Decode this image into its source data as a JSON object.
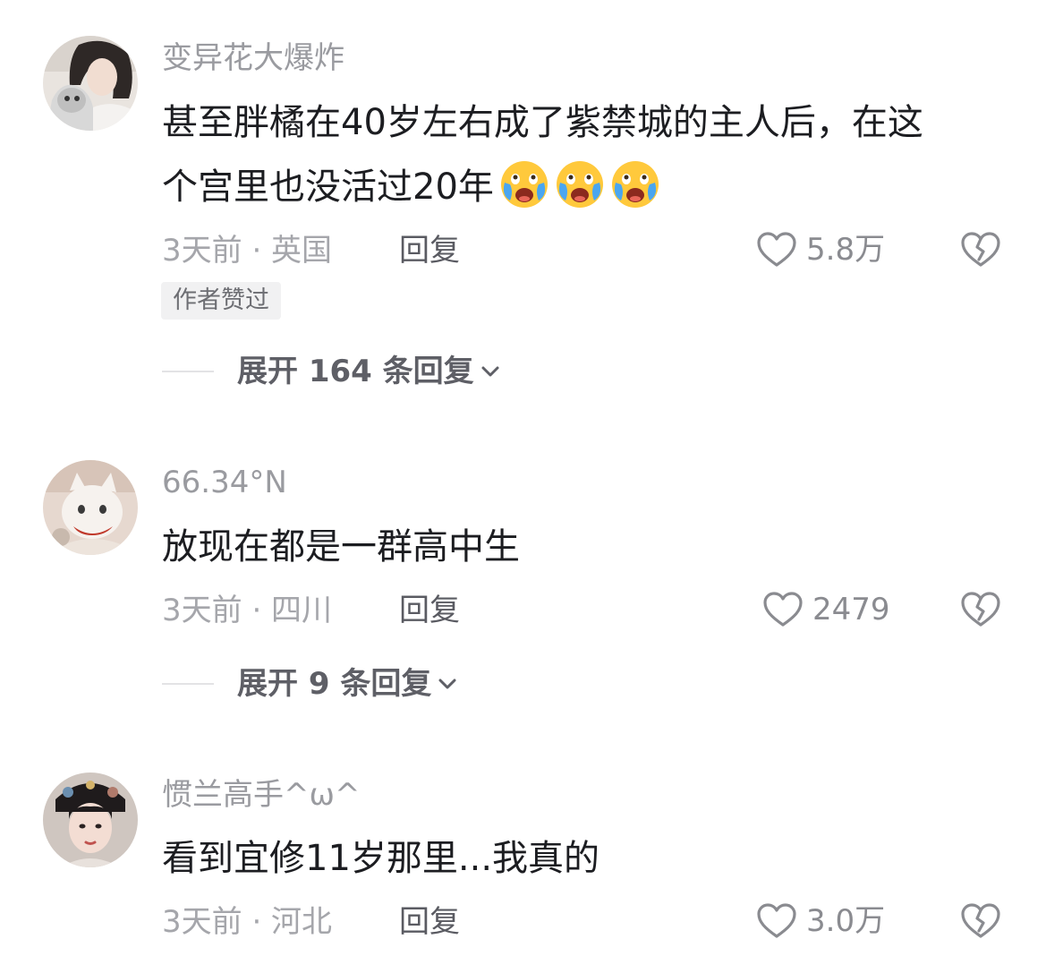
{
  "comments": [
    {
      "username": "变异花大爆炸",
      "content_line1": "甚至胖橘在40岁左右成了紫禁城的主人后，在这",
      "content_line2": "个宫里也没活过20年",
      "emoji": "crying-face-emoji",
      "emoji_count": 3,
      "meta": "3天前 · 英国",
      "reply_label": "回复",
      "likes": "5.8万",
      "badge": "作者赞过",
      "expand_label": "展开 164 条回复"
    },
    {
      "username": "66.34°N",
      "content_line1": "放现在都是一群高中生",
      "meta": "3天前 · 四川",
      "reply_label": "回复",
      "likes": "2479",
      "expand_label": "展开 9 条回复"
    },
    {
      "username": "惯兰高手^ω^",
      "content_line1": "看到宜修11岁那里...我真的",
      "meta": "3天前 · 河北",
      "reply_label": "回复",
      "likes": "3.0万"
    }
  ],
  "icons": {
    "like": "heart-outline-icon",
    "dislike": "broken-heart-icon",
    "expand": "chevron-down-icon"
  },
  "colors": {
    "text": "#1c1d21",
    "secondary": "#9a9ba0",
    "reply": "#5a5b62",
    "badge_bg": "#f1f1f2"
  }
}
